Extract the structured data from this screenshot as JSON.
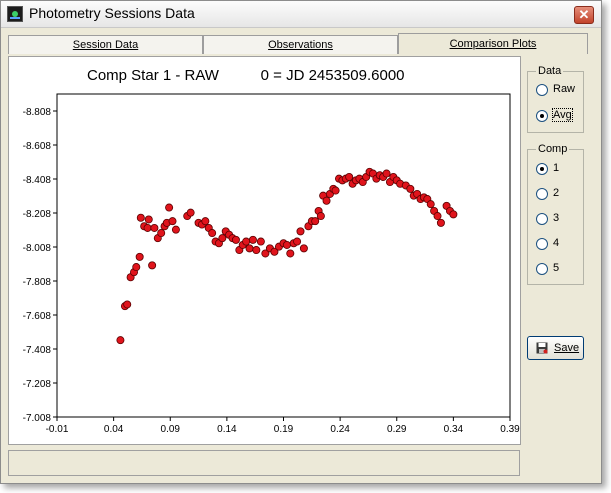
{
  "window": {
    "title": "Photometry Sessions Data",
    "close_label": "✕"
  },
  "tabs": [
    {
      "label": "Session Data"
    },
    {
      "label": "Observations"
    },
    {
      "label": "Comparison Plots"
    }
  ],
  "data_group": {
    "label": "Data",
    "options": [
      {
        "label": "Raw",
        "checked": false
      },
      {
        "label": "Avg",
        "checked": true
      }
    ]
  },
  "comp_group": {
    "label": "Comp",
    "options": [
      {
        "label": "1",
        "checked": true
      },
      {
        "label": "2",
        "checked": false
      },
      {
        "label": "3",
        "checked": false
      },
      {
        "label": "4",
        "checked": false
      },
      {
        "label": "5",
        "checked": false
      }
    ]
  },
  "save_label": "Save",
  "chart_data": {
    "type": "scatter",
    "title": "Comp Star 1 - RAW",
    "subtitle": "0 = JD 2453509.6000",
    "xlim": [
      -0.01,
      0.39
    ],
    "ylim": [
      -8.908,
      -7.008
    ],
    "y_inverted": true,
    "x_ticks": [
      "-0.01",
      "0.04",
      "0.09",
      "0.14",
      "0.19",
      "0.24",
      "0.29",
      "0.34",
      "0.39"
    ],
    "y_ticks": [
      "-8.808",
      "-8.608",
      "-8.408",
      "-8.208",
      "-8.008",
      "-7.808",
      "-7.608",
      "-7.408",
      "-7.208",
      "-7.008"
    ],
    "marker_color": "#e0141c",
    "points": [
      [
        0.046,
        -7.46
      ],
      [
        0.05,
        -7.66
      ],
      [
        0.052,
        -7.67
      ],
      [
        0.055,
        -7.83
      ],
      [
        0.058,
        -7.86
      ],
      [
        0.06,
        -7.89
      ],
      [
        0.063,
        -7.95
      ],
      [
        0.064,
        -8.18
      ],
      [
        0.067,
        -8.13
      ],
      [
        0.07,
        -8.12
      ],
      [
        0.071,
        -8.17
      ],
      [
        0.074,
        -7.9
      ],
      [
        0.076,
        -8.12
      ],
      [
        0.079,
        -8.06
      ],
      [
        0.082,
        -8.09
      ],
      [
        0.085,
        -8.13
      ],
      [
        0.087,
        -8.15
      ],
      [
        0.089,
        -8.24
      ],
      [
        0.092,
        -8.16
      ],
      [
        0.095,
        -8.11
      ],
      [
        0.105,
        -8.19
      ],
      [
        0.108,
        -8.21
      ],
      [
        0.115,
        -8.15
      ],
      [
        0.118,
        -8.14
      ],
      [
        0.121,
        -8.16
      ],
      [
        0.124,
        -8.12
      ],
      [
        0.127,
        -8.09
      ],
      [
        0.13,
        -8.04
      ],
      [
        0.133,
        -8.03
      ],
      [
        0.136,
        -8.06
      ],
      [
        0.139,
        -8.1
      ],
      [
        0.142,
        -8.08
      ],
      [
        0.145,
        -8.06
      ],
      [
        0.148,
        -8.05
      ],
      [
        0.151,
        -7.99
      ],
      [
        0.154,
        -8.02
      ],
      [
        0.157,
        -8.04
      ],
      [
        0.16,
        -8.0
      ],
      [
        0.163,
        -8.05
      ],
      [
        0.166,
        -7.99
      ],
      [
        0.17,
        -8.04
      ],
      [
        0.174,
        -7.97
      ],
      [
        0.178,
        -8.0
      ],
      [
        0.182,
        -7.98
      ],
      [
        0.186,
        -8.01
      ],
      [
        0.19,
        -8.03
      ],
      [
        0.193,
        -8.02
      ],
      [
        0.196,
        -7.97
      ],
      [
        0.199,
        -8.03
      ],
      [
        0.202,
        -8.04
      ],
      [
        0.205,
        -8.1
      ],
      [
        0.208,
        -8.0
      ],
      [
        0.212,
        -8.13
      ],
      [
        0.215,
        -8.16
      ],
      [
        0.218,
        -8.16
      ],
      [
        0.221,
        -8.22
      ],
      [
        0.223,
        -8.19
      ],
      [
        0.225,
        -8.31
      ],
      [
        0.228,
        -8.28
      ],
      [
        0.231,
        -8.32
      ],
      [
        0.234,
        -8.35
      ],
      [
        0.236,
        -8.34
      ],
      [
        0.239,
        -8.41
      ],
      [
        0.242,
        -8.4
      ],
      [
        0.245,
        -8.41
      ],
      [
        0.248,
        -8.42
      ],
      [
        0.251,
        -8.38
      ],
      [
        0.254,
        -8.4
      ],
      [
        0.257,
        -8.41
      ],
      [
        0.26,
        -8.39
      ],
      [
        0.263,
        -8.42
      ],
      [
        0.266,
        -8.45
      ],
      [
        0.269,
        -8.44
      ],
      [
        0.272,
        -8.41
      ],
      [
        0.275,
        -8.43
      ],
      [
        0.278,
        -8.42
      ],
      [
        0.281,
        -8.44
      ],
      [
        0.284,
        -8.39
      ],
      [
        0.287,
        -8.42
      ],
      [
        0.29,
        -8.4
      ],
      [
        0.293,
        -8.38
      ],
      [
        0.298,
        -8.37
      ],
      [
        0.302,
        -8.35
      ],
      [
        0.305,
        -8.31
      ],
      [
        0.308,
        -8.32
      ],
      [
        0.311,
        -8.29
      ],
      [
        0.314,
        -8.3
      ],
      [
        0.317,
        -8.29
      ],
      [
        0.32,
        -8.26
      ],
      [
        0.323,
        -8.22
      ],
      [
        0.326,
        -8.19
      ],
      [
        0.329,
        -8.15
      ],
      [
        0.334,
        -8.25
      ],
      [
        0.337,
        -8.22
      ],
      [
        0.34,
        -8.2
      ]
    ]
  }
}
